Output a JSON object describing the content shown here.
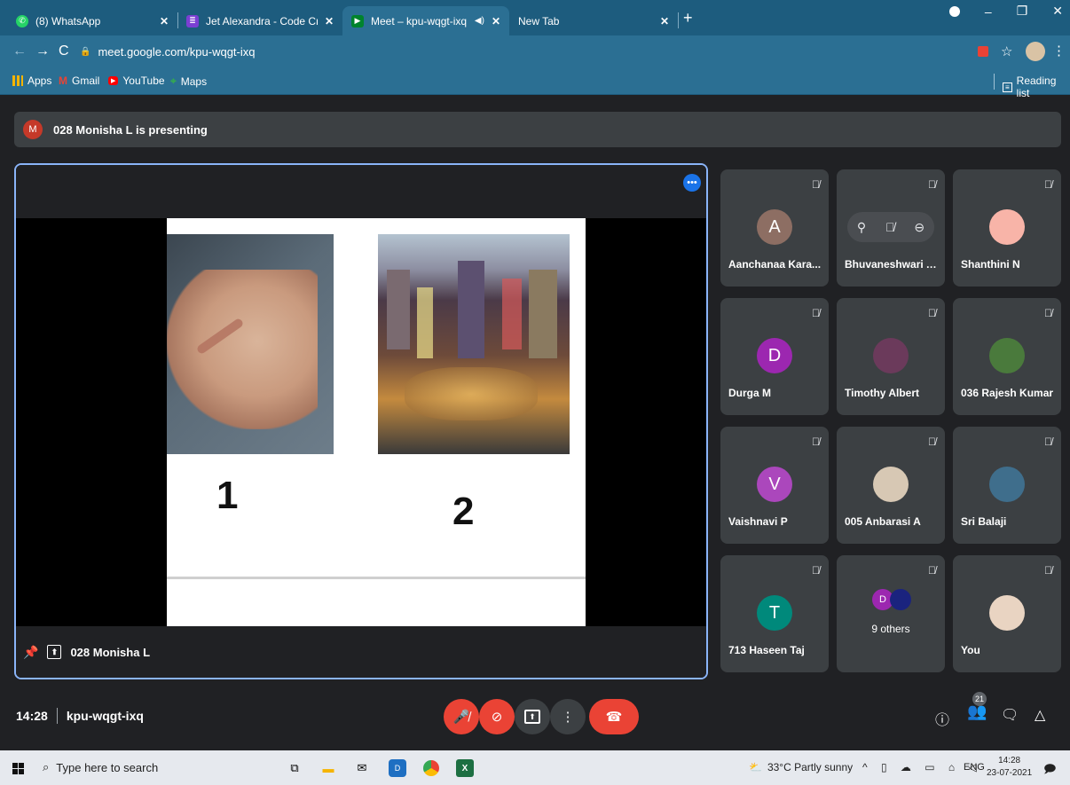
{
  "tabs": [
    {
      "title": "(8) WhatsApp",
      "icon": "whatsapp-icon",
      "color": "#25d366"
    },
    {
      "title": "Jet Alexandra - Code Crackers - C",
      "icon": "classroom-icon",
      "color": "#7b3fd3"
    },
    {
      "title": "Meet – kpu-wqgt-ixq",
      "icon": "meet-icon",
      "color": "#00832d"
    },
    {
      "title": "New Tab",
      "icon": "",
      "color": ""
    }
  ],
  "address": {
    "url": "meet.google.com/kpu-wqgt-ixq"
  },
  "bookmarks": {
    "apps": "Apps",
    "gmail": "Gmail",
    "youtube": "YouTube",
    "maps": "Maps",
    "reading_list": "Reading list"
  },
  "meet": {
    "presenting": "028 Monisha L is presenting",
    "presenter_initial": "M",
    "presenter_name": "028 Monisha L",
    "slide_labels": [
      "1",
      "2"
    ],
    "participants": [
      {
        "name": "Aanchanaa Kara...",
        "initial": "A",
        "color": "#8d6e63"
      },
      {
        "name": "Bhuvaneshwari Ar...",
        "initial": "",
        "color": ""
      },
      {
        "name": "Shanthini N",
        "initial": "",
        "color": "#f8b4a8"
      },
      {
        "name": "Durga M",
        "initial": "D",
        "color": "#9c27b0"
      },
      {
        "name": "Timothy Albert",
        "initial": "",
        "color": "#6b3a5b"
      },
      {
        "name": "036 Rajesh Kumar",
        "initial": "",
        "color": "#4a7a3c"
      },
      {
        "name": "Vaishnavi P",
        "initial": "V",
        "color": "#ab47bc"
      },
      {
        "name": "005 Anbarasi A",
        "initial": "",
        "color": "#d7c8b4"
      },
      {
        "name": "Sri Balaji",
        "initial": "",
        "color": "#3f6e8c"
      },
      {
        "name": "713 Haseen Taj",
        "initial": "T",
        "color": "#00897b"
      },
      {
        "name": "9 others",
        "initial": "D",
        "color": "#9c27b0"
      },
      {
        "name": "You",
        "initial": "",
        "color": "#e9d4c2"
      }
    ],
    "time": "14:28",
    "meeting_code": "kpu-wqgt-ixq",
    "participant_count": "21"
  },
  "taskbar": {
    "search_placeholder": "Type here to search",
    "weather": "33°C  Partly sunny",
    "lang": "ENG",
    "clock_time": "14:28",
    "clock_date": "23-07-2021",
    "notification_count": "1"
  }
}
